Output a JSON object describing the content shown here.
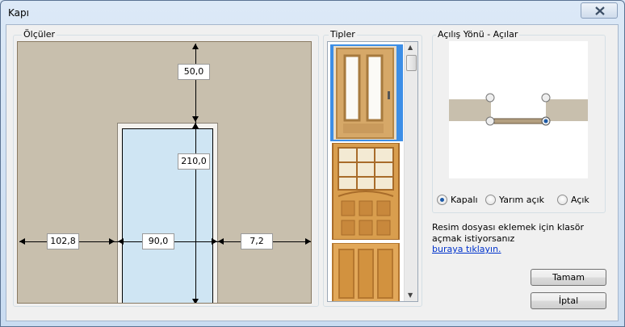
{
  "window": {
    "title": "Kapı"
  },
  "dimensions": {
    "group_label": "Ölçüler",
    "top_gap": "50,0",
    "height": "210,0",
    "left_offset": "102,8",
    "width": "90,0",
    "right_offset": "7,2"
  },
  "types": {
    "group_label": "Tipler",
    "items": [
      "door-type-1",
      "door-type-2",
      "door-type-3"
    ],
    "selected_index": 0
  },
  "direction": {
    "group_label": "Açılış Yönü - Açılar",
    "options": [
      {
        "label": "Kapalı",
        "checked": true
      },
      {
        "label": "Yarım açık",
        "checked": false
      },
      {
        "label": "Açık",
        "checked": false
      }
    ]
  },
  "info": {
    "line1": "Resim dosyası eklemek için klasör",
    "line2": "açmak istiyorsanız",
    "link": "buraya tıklayın."
  },
  "buttons": {
    "ok": "Tamam",
    "cancel": "İptal"
  },
  "colors": {
    "wall": "#c8bfad",
    "glass": "#cfe5f3",
    "selection": "#3d8ee6",
    "link": "#0033cc"
  }
}
